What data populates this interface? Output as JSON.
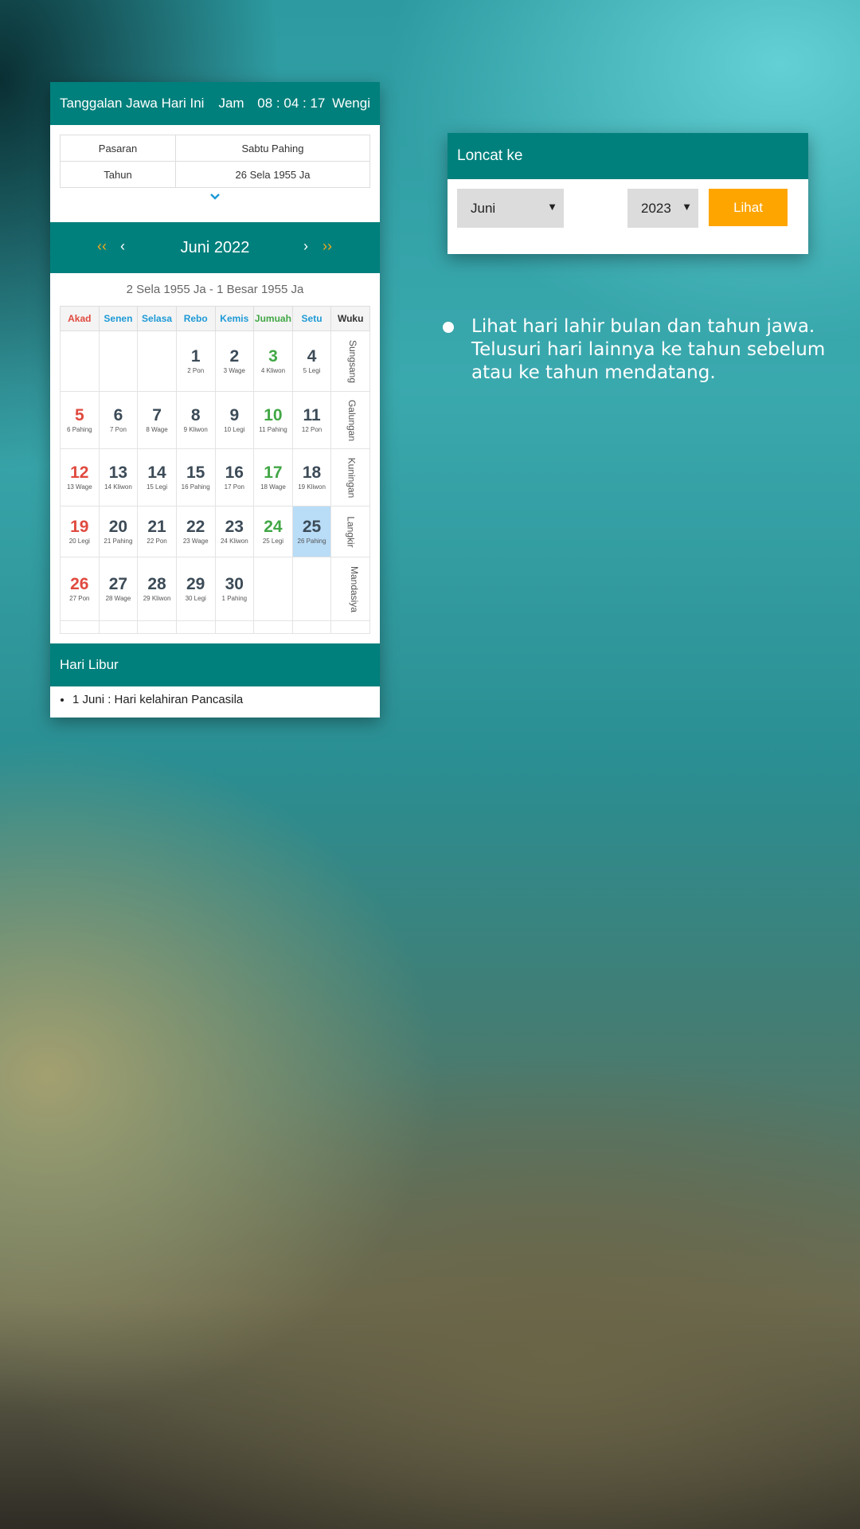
{
  "header": {
    "title": "Tanggalan Jawa Hari Ini",
    "jam_label": "Jam",
    "time": "08 : 04 : 17",
    "period": "Wengi"
  },
  "info": {
    "rows": [
      {
        "label": "Pasaran",
        "value": "Sabtu Pahing"
      },
      {
        "label": "Tahun",
        "value": "26 Sela 1955 Ja"
      }
    ],
    "expand_icon": "chevron-down-icon"
  },
  "nav": {
    "prev_year": "‹‹",
    "prev": "‹",
    "month_title": "Juni 2022",
    "next": "›",
    "next_year": "››"
  },
  "java_range": "2 Sela 1955 Ja - 1 Besar 1955 Ja",
  "weekdays": [
    {
      "label": "Akad",
      "color": "#e04a3f"
    },
    {
      "label": "Senen",
      "color": "#1e9ad6"
    },
    {
      "label": "Selasa",
      "color": "#1e9ad6"
    },
    {
      "label": "Rebo",
      "color": "#1e9ad6"
    },
    {
      "label": "Kemis",
      "color": "#1e9ad6"
    },
    {
      "label": "Jumuah",
      "color": "#41a745"
    },
    {
      "label": "Setu",
      "color": "#1e9ad6"
    },
    {
      "label": "Wuku",
      "color": "#333333"
    }
  ],
  "weeks": [
    {
      "wuku": "Sungsang",
      "days": [
        null,
        null,
        null,
        {
          "d": "1",
          "j": "2 Pon"
        },
        {
          "d": "2",
          "j": "3 Wage"
        },
        {
          "d": "3",
          "j": "4 Kliwon"
        },
        {
          "d": "4",
          "j": "5 Legi"
        }
      ]
    },
    {
      "wuku": "Galungan",
      "days": [
        {
          "d": "5",
          "j": "6 Pahing"
        },
        {
          "d": "6",
          "j": "7 Pon"
        },
        {
          "d": "7",
          "j": "8 Wage"
        },
        {
          "d": "8",
          "j": "9 Kliwon"
        },
        {
          "d": "9",
          "j": "10 Legi"
        },
        {
          "d": "10",
          "j": "11 Pahing"
        },
        {
          "d": "11",
          "j": "12 Pon"
        }
      ]
    },
    {
      "wuku": "Kuningan",
      "days": [
        {
          "d": "12",
          "j": "13 Wage"
        },
        {
          "d": "13",
          "j": "14 Kliwon"
        },
        {
          "d": "14",
          "j": "15 Legi"
        },
        {
          "d": "15",
          "j": "16 Pahing"
        },
        {
          "d": "16",
          "j": "17 Pon"
        },
        {
          "d": "17",
          "j": "18 Wage"
        },
        {
          "d": "18",
          "j": "19 Kliwon"
        }
      ]
    },
    {
      "wuku": "Langkir",
      "days": [
        {
          "d": "19",
          "j": "20 Legi"
        },
        {
          "d": "20",
          "j": "21 Pahing"
        },
        {
          "d": "21",
          "j": "22 Pon"
        },
        {
          "d": "22",
          "j": "23 Wage"
        },
        {
          "d": "23",
          "j": "24 Kliwon"
        },
        {
          "d": "24",
          "j": "25 Legi"
        },
        {
          "d": "25",
          "j": "26 Pahing",
          "today": true
        }
      ]
    },
    {
      "wuku": "Mandasiya",
      "days": [
        {
          "d": "26",
          "j": "27 Pon"
        },
        {
          "d": "27",
          "j": "28 Wage"
        },
        {
          "d": "28",
          "j": "29 Kliwon"
        },
        {
          "d": "29",
          "j": "30 Legi"
        },
        {
          "d": "30",
          "j": "1 Pahing"
        },
        null,
        null
      ]
    }
  ],
  "holidays": {
    "title": "Hari Libur",
    "items": [
      "1 Juni : Hari kelahiran Pancasila"
    ]
  },
  "jump": {
    "title": "Loncat ke",
    "month_value": "Juni",
    "year_value": "2023",
    "button": "Lihat"
  },
  "description": "Lihat hari lahir bulan dan tahun jawa. Telusuri hari lainnya ke tahun sebelum atau ke tahun mendatang.",
  "colors": {
    "teal": "#00807c",
    "orange": "#ffa500",
    "today": "#b9dcf7",
    "sunday": "#e04a3f",
    "friday": "#41a745"
  }
}
